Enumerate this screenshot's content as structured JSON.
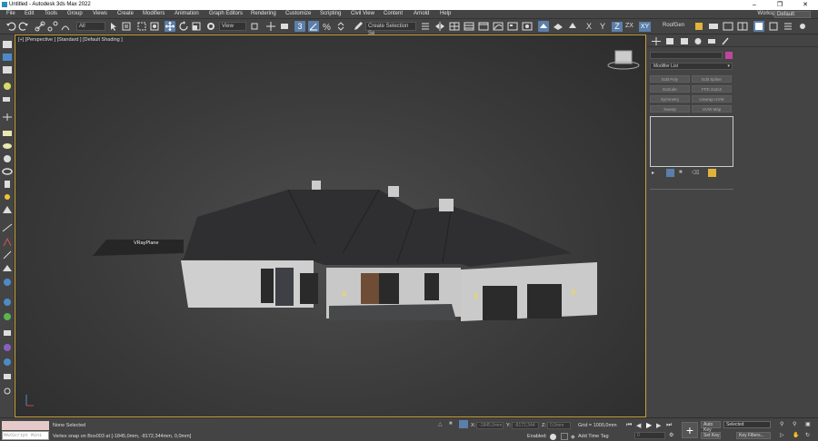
{
  "window": {
    "title": "Untitled - Autodesk 3ds Max 2022"
  },
  "menu": {
    "items": [
      "File",
      "Edit",
      "Tools",
      "Group",
      "Views",
      "Create",
      "Modifiers",
      "Animation",
      "Graph Editors",
      "Rendering",
      "Customize",
      "Scripting",
      "Civil View",
      "Content",
      "Arnold",
      "Help"
    ],
    "workspaces_label": "Workspaces:",
    "workspace_value": "Default"
  },
  "toolbar": {
    "filter_value": "All",
    "refcoord_value": "View",
    "selset_placeholder": "Create Selection Se",
    "snap_value": "3",
    "roofgen_label": "RoofGen",
    "axis_labels": [
      "X",
      "Y",
      "Z",
      "ZX",
      "XY"
    ]
  },
  "viewport": {
    "label": "[+] [Perspective ] [Standard ] [Default Shading ]",
    "object_label": "VRayPlane"
  },
  "command_panel": {
    "modifier_list_label": "Modifier List",
    "modifier_buttons": [
      "Edit Poly",
      "Edit Spline",
      "Extrude",
      "FFD 2x2x2",
      "Symmetry",
      "Unwrap UVW",
      "Sweep",
      "UVW Map"
    ],
    "accent_color": "#c0469b"
  },
  "status": {
    "selection": "None Selected",
    "prompt": "Vertex snap on Box003 at [-1845,0mm, -8172,344mm, 0,0mm]",
    "maxscript_label": "MAXScript Mini",
    "x_label": "X:",
    "x_value": "-1845,0mm",
    "y_label": "Y:",
    "y_value": "-8172,344",
    "z_label": "Z:",
    "z_value": "0,0mm",
    "grid": "Grid = 1000,0mm",
    "enabled_label": "Enabled:",
    "add_time_tag": "Add Time Tag",
    "frame_value": "0",
    "autokey": "Auto Key",
    "setkey": "Set Key",
    "selected_value": "Selected",
    "key_filters": "Key Filters..."
  }
}
